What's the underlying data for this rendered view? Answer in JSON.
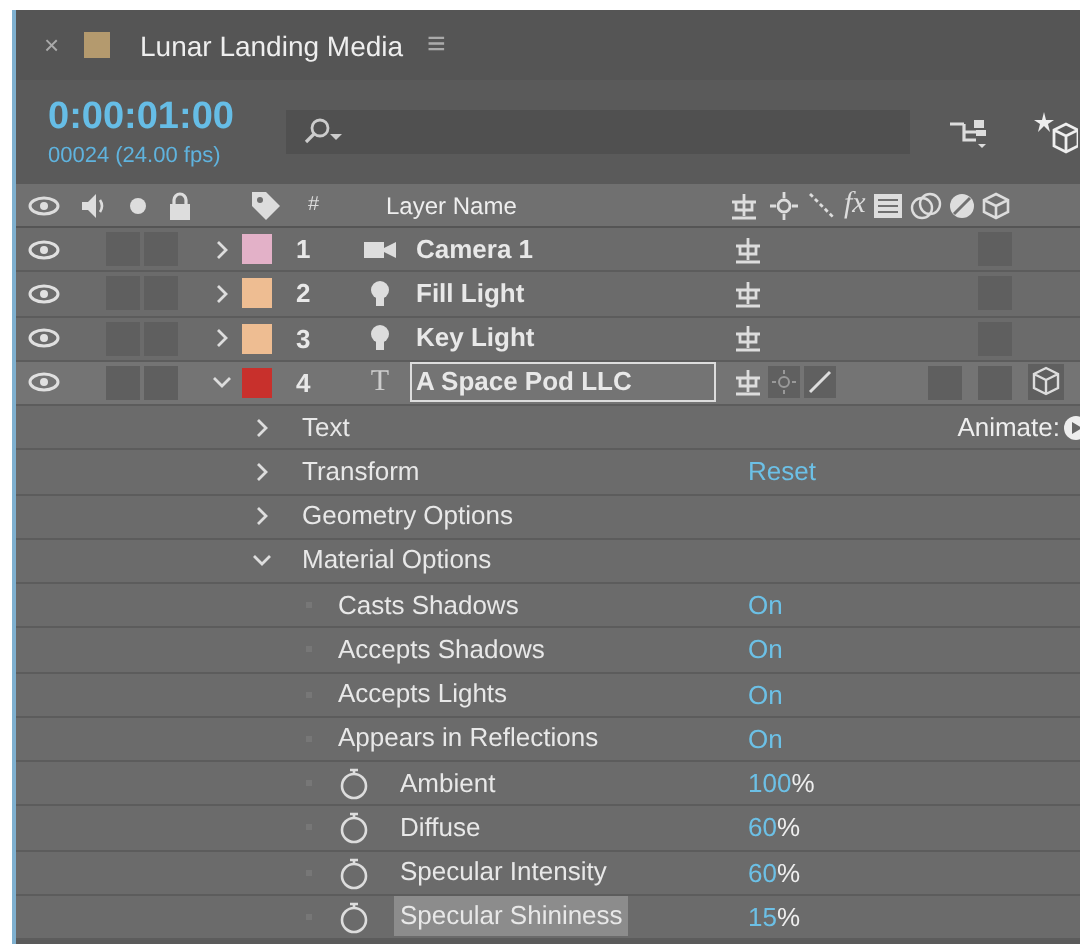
{
  "panel": {
    "close_glyph": "×",
    "title": "Lunar Landing Media",
    "menu_glyph": "≡"
  },
  "time": {
    "timecode": "0:00:01:00",
    "frame_info": "00024 (24.00 fps)"
  },
  "header": {
    "number_label": "#",
    "name_label": "Layer Name",
    "effects_label": "fx"
  },
  "layers": [
    {
      "number": "1",
      "name": "Camera 1",
      "kind": "camera",
      "color": "#e3b1c8",
      "expanded": false,
      "selected": false,
      "editing": false,
      "is_3d": false
    },
    {
      "number": "2",
      "name": "Fill Light",
      "kind": "light",
      "color": "#eebd92",
      "expanded": false,
      "selected": false,
      "editing": false,
      "is_3d": false
    },
    {
      "number": "3",
      "name": "Key  Light",
      "kind": "light",
      "color": "#eebd92",
      "expanded": false,
      "selected": false,
      "editing": false,
      "is_3d": false
    },
    {
      "number": "4",
      "name": "A Space Pod LLC",
      "kind": "text",
      "icon_glyph": "T",
      "color": "#c8302c",
      "expanded": true,
      "selected": true,
      "editing": true,
      "is_3d": true
    }
  ],
  "properties": [
    {
      "kind": "group",
      "name": "Text",
      "expanded": false,
      "selected": false,
      "action": "Animate:"
    },
    {
      "kind": "group",
      "name": "Transform",
      "expanded": false,
      "selected": false,
      "value": "Reset"
    },
    {
      "kind": "group",
      "name": "Geometry Options",
      "expanded": false,
      "selected": false
    },
    {
      "kind": "group",
      "name": "Material Options",
      "expanded": true,
      "selected": false
    },
    {
      "kind": "switch",
      "name": "Casts Shadows",
      "value": "On",
      "selected": false
    },
    {
      "kind": "switch",
      "name": "Accepts Shadows",
      "value": "On",
      "selected": false
    },
    {
      "kind": "switch",
      "name": "Accepts Lights",
      "value": "On",
      "selected": false
    },
    {
      "kind": "switch",
      "name": "Appears in Reflections",
      "value": "On",
      "selected": false
    },
    {
      "kind": "percent",
      "name": "Ambient",
      "value": "100",
      "unit": "%",
      "selected": false
    },
    {
      "kind": "percent",
      "name": "Diffuse",
      "value": "60",
      "unit": "%",
      "selected": false
    },
    {
      "kind": "percent",
      "name": "Specular Intensity",
      "value": "60",
      "unit": "%",
      "selected": false
    },
    {
      "kind": "percent",
      "name": "Specular Shininess",
      "value": "15",
      "unit": "%",
      "selected": true
    }
  ]
}
